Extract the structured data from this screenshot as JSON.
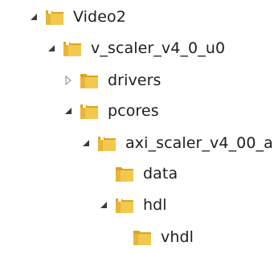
{
  "tree": {
    "nodes": [
      {
        "label": "Video2",
        "state": "expanded"
      },
      {
        "label": "v_scaler_v4_0_u0",
        "state": "expanded"
      },
      {
        "label": "drivers",
        "state": "collapsed"
      },
      {
        "label": "pcores",
        "state": "expanded"
      },
      {
        "label": "axi_scaler_v4_00_a",
        "state": "expanded"
      },
      {
        "label": "data",
        "state": "leaf"
      },
      {
        "label": "hdl",
        "state": "expanded"
      },
      {
        "label": "vhdl",
        "state": "leaf"
      }
    ]
  },
  "colors": {
    "folder_front": "#f3c84f",
    "folder_back": "#d9a521",
    "expand_arrow": "#3a3a3a",
    "collapse_arrow": "#9a9a9a",
    "text": "#1e1e1e"
  }
}
